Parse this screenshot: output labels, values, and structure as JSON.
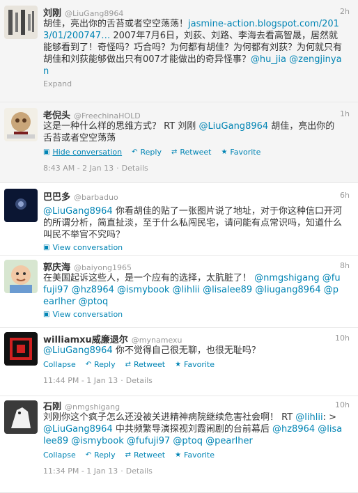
{
  "tweets": [
    {
      "name": "刘刚",
      "handle": "@LiuGang8964",
      "time": "2h",
      "text_a": "胡佳，亮出你的舌苔或者空空荡荡！",
      "link1": "jasmine-action.blogspot.com/2013/01/200747…",
      "text_b": " 2007年7月6日，刘荻、刘路、李海去看高智晟，居然就能够看到了！奇怪吗？巧合吗？为何都有胡佳？为何都有刘荻？为何就只有胡佳和刘荻能够做出只有007才能做出的奇异怪事？",
      "mention1": "@hu_jia",
      "mention2": "@zengjinyan",
      "expand": "Expand"
    },
    {
      "name": "老倪头",
      "handle": "@FreechinaHOLD",
      "time": "1h",
      "text_a": "这是一种什么样的思维方式？ RT 刘刚 ",
      "mention1": "@LiuGang8964",
      "text_b": " 胡佳，亮出你的舌苔或者空空荡荡",
      "action_hide": "Hide conversation",
      "action_reply": "Reply",
      "action_retweet": "Retweet",
      "action_favorite": "Favorite",
      "meta_time": "8:43 AM - 2 Jan 13",
      "meta_details": "Details"
    },
    {
      "name": "巴巴多",
      "handle": "@barbaduo",
      "time": "6h",
      "mention1": "@LiuGang8964",
      "text_b": " 你看胡佳的贴了一张图片说了地址，对于你这种信口开河的所谓分析，简直扯淡，至于什么私闯民宅，请问能有点常识吗，知道什么叫民不举官不究吗？",
      "view_conv": "View conversation"
    },
    {
      "name": "郭庆海",
      "handle": "@baiyong1965",
      "time": "8h",
      "text_a": "在美国起诉这些人，是一个应有的选择，太肮脏了！ ",
      "mentions": [
        "@nmgshigang",
        "@fufuji97",
        "@hz8964",
        "@ismybook",
        "@lihlii",
        "@lisalee89",
        "@liugang8964",
        "@pearlher",
        "@ptoq"
      ],
      "view_conv": "View conversation"
    },
    {
      "name": "williamxu威廉退尔",
      "handle": "@mynamexu",
      "time": "10h",
      "mention1": "@LiuGang8964",
      "text_b": " 你不觉得自己很无聊，也很无耻吗？",
      "action_collapse": "Collapse",
      "action_reply": "Reply",
      "action_retweet": "Retweet",
      "action_favorite": "Favorite",
      "meta_time": "11:44 PM - 1 Jan 13",
      "meta_details": "Details"
    },
    {
      "name": "石刚",
      "handle": "@nmgshigang",
      "time": "10h",
      "text_a": "刘刚你这个疯子怎么还没被关进精神病院继续危害社会啊！ RT ",
      "mention_lihlii": "@lihlii",
      "text_b": ": >",
      "mention_liugang": "@LiuGang8964",
      "text_c": " 中共频繁导演探视刘霞闹剧的台前幕后 ",
      "mentions": [
        "@hz8964",
        "@lisalee89",
        "@ismybook",
        "@fufuji97",
        "@ptoq",
        "@pearlher"
      ],
      "action_collapse": "Collapse",
      "action_reply": "Reply",
      "action_retweet": "Retweet",
      "action_favorite": "Favorite",
      "meta_time": "11:34 PM - 1 Jan 13",
      "meta_details": "Details"
    }
  ]
}
